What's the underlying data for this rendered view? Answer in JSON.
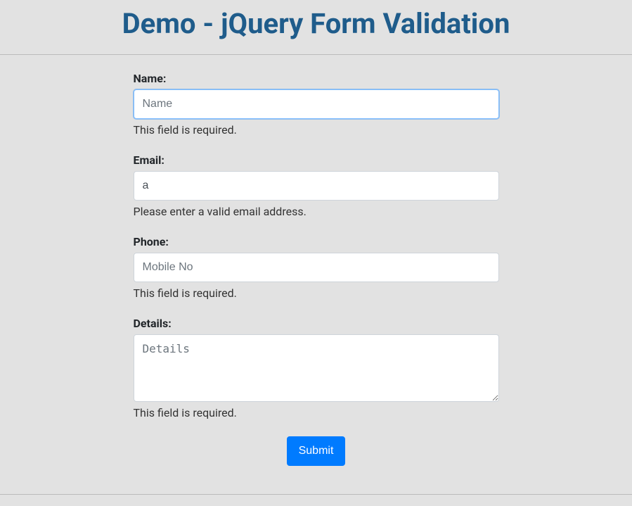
{
  "title": "Demo - jQuery Form Validation",
  "form": {
    "name": {
      "label": "Name:",
      "placeholder": "Name",
      "value": "",
      "error": "This field is required."
    },
    "email": {
      "label": "Email:",
      "placeholder": "",
      "value": "a",
      "error": "Please enter a valid email address."
    },
    "phone": {
      "label": "Phone:",
      "placeholder": "Mobile No",
      "value": "",
      "error": "This field is required."
    },
    "details": {
      "label": "Details:",
      "placeholder": "Details",
      "value": "",
      "error": "This field is required."
    },
    "submit_label": "Submit"
  }
}
